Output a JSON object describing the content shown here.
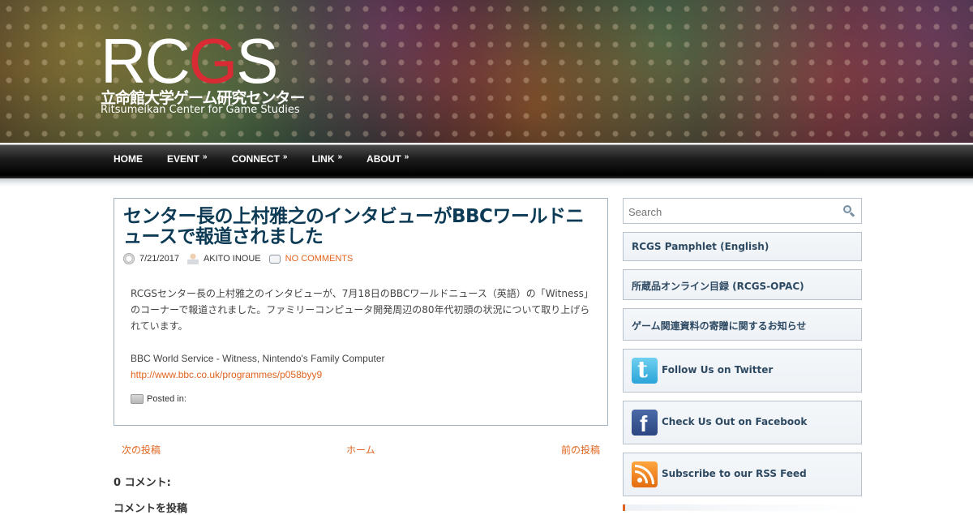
{
  "logo": {
    "part1": "RC",
    "part2": "G",
    "part3": "S",
    "jp": "立命館大学ゲーム研究センター",
    "en": "Ritsumeikan Center for Game Studies",
    "accent_color": "#d82b34"
  },
  "nav": {
    "items": [
      {
        "label": "HOME",
        "has_submenu": false
      },
      {
        "label": "EVENT",
        "has_submenu": true
      },
      {
        "label": "CONNECT",
        "has_submenu": true
      },
      {
        "label": "LINK",
        "has_submenu": true
      },
      {
        "label": "ABOUT",
        "has_submenu": true
      }
    ],
    "submenu_glyph": "»"
  },
  "post": {
    "title": "センター長の上村雅之のインタビューがBBCワールドニュースで報道されました",
    "date": "7/21/2017",
    "author": "AKITO INOUE",
    "comments_link": "NO COMMENTS",
    "body": "RCGSセンター長の上村雅之のインタビューが、7月18日のBBCワールドニュース（英語）の「Witness」のコーナーで報道されました。ファミリーコンピュータ開発周辺の80年代初頭の状況について取り上げられています。",
    "source_line": "BBC World Service - Witness, Nintendo's Family Computer",
    "url": "http://www.bbc.co.uk/programmes/p058byy9",
    "posted_in": "Posted in:",
    "title_color": "#0d3b55",
    "link_color": "#e1641e"
  },
  "pager": {
    "next": "次の投稿",
    "home": "ホーム",
    "prev": "前の投稿"
  },
  "comments": {
    "count_heading": "0 コメント:",
    "post_heading": "コメントを投稿"
  },
  "sidebar": {
    "search_placeholder": "Search",
    "links": [
      "RCGS Pamphlet (English)",
      "所蔵品オンライン目録 (RCGS-OPAC)",
      "ゲーム関連資料の寄贈に関するお知らせ"
    ],
    "social": [
      {
        "icon": "twitter-icon",
        "label": "Follow Us on Twitter"
      },
      {
        "icon": "facebook-icon",
        "label": "Check Us Out on Facebook"
      },
      {
        "icon": "rss-icon",
        "label": "Subscribe to our RSS Feed"
      }
    ]
  }
}
